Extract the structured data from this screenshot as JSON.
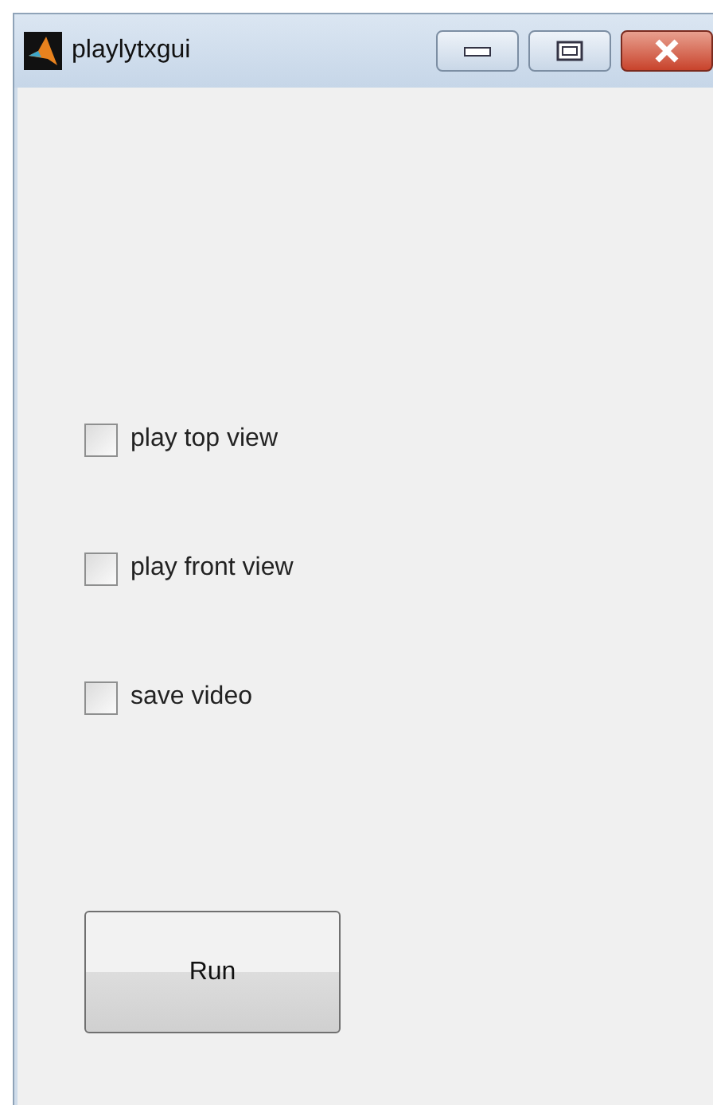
{
  "window": {
    "title": "playlytxgui"
  },
  "checkboxes": [
    {
      "label": "play top view",
      "checked": false
    },
    {
      "label": "play front view",
      "checked": false
    },
    {
      "label": "save video",
      "checked": false
    }
  ],
  "buttons": [
    {
      "label": "Run"
    }
  ]
}
